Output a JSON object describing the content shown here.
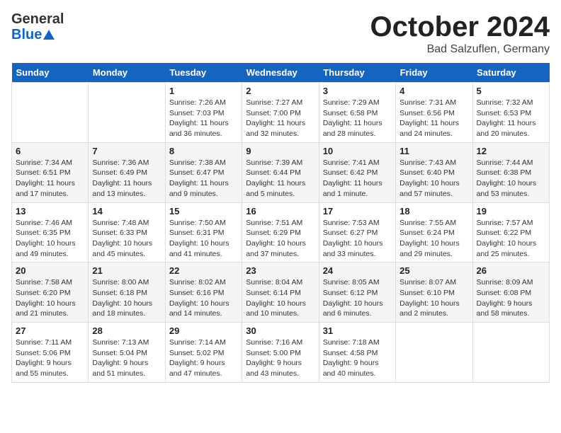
{
  "header": {
    "logo_line1": "General",
    "logo_line2": "Blue",
    "month": "October 2024",
    "location": "Bad Salzuflen, Germany"
  },
  "days_of_week": [
    "Sunday",
    "Monday",
    "Tuesday",
    "Wednesday",
    "Thursday",
    "Friday",
    "Saturday"
  ],
  "weeks": [
    [
      {
        "day": "",
        "info": ""
      },
      {
        "day": "",
        "info": ""
      },
      {
        "day": "1",
        "info": "Sunrise: 7:26 AM\nSunset: 7:03 PM\nDaylight: 11 hours\nand 36 minutes."
      },
      {
        "day": "2",
        "info": "Sunrise: 7:27 AM\nSunset: 7:00 PM\nDaylight: 11 hours\nand 32 minutes."
      },
      {
        "day": "3",
        "info": "Sunrise: 7:29 AM\nSunset: 6:58 PM\nDaylight: 11 hours\nand 28 minutes."
      },
      {
        "day": "4",
        "info": "Sunrise: 7:31 AM\nSunset: 6:56 PM\nDaylight: 11 hours\nand 24 minutes."
      },
      {
        "day": "5",
        "info": "Sunrise: 7:32 AM\nSunset: 6:53 PM\nDaylight: 11 hours\nand 20 minutes."
      }
    ],
    [
      {
        "day": "6",
        "info": "Sunrise: 7:34 AM\nSunset: 6:51 PM\nDaylight: 11 hours\nand 17 minutes."
      },
      {
        "day": "7",
        "info": "Sunrise: 7:36 AM\nSunset: 6:49 PM\nDaylight: 11 hours\nand 13 minutes."
      },
      {
        "day": "8",
        "info": "Sunrise: 7:38 AM\nSunset: 6:47 PM\nDaylight: 11 hours\nand 9 minutes."
      },
      {
        "day": "9",
        "info": "Sunrise: 7:39 AM\nSunset: 6:44 PM\nDaylight: 11 hours\nand 5 minutes."
      },
      {
        "day": "10",
        "info": "Sunrise: 7:41 AM\nSunset: 6:42 PM\nDaylight: 11 hours\nand 1 minute."
      },
      {
        "day": "11",
        "info": "Sunrise: 7:43 AM\nSunset: 6:40 PM\nDaylight: 10 hours\nand 57 minutes."
      },
      {
        "day": "12",
        "info": "Sunrise: 7:44 AM\nSunset: 6:38 PM\nDaylight: 10 hours\nand 53 minutes."
      }
    ],
    [
      {
        "day": "13",
        "info": "Sunrise: 7:46 AM\nSunset: 6:35 PM\nDaylight: 10 hours\nand 49 minutes."
      },
      {
        "day": "14",
        "info": "Sunrise: 7:48 AM\nSunset: 6:33 PM\nDaylight: 10 hours\nand 45 minutes."
      },
      {
        "day": "15",
        "info": "Sunrise: 7:50 AM\nSunset: 6:31 PM\nDaylight: 10 hours\nand 41 minutes."
      },
      {
        "day": "16",
        "info": "Sunrise: 7:51 AM\nSunset: 6:29 PM\nDaylight: 10 hours\nand 37 minutes."
      },
      {
        "day": "17",
        "info": "Sunrise: 7:53 AM\nSunset: 6:27 PM\nDaylight: 10 hours\nand 33 minutes."
      },
      {
        "day": "18",
        "info": "Sunrise: 7:55 AM\nSunset: 6:24 PM\nDaylight: 10 hours\nand 29 minutes."
      },
      {
        "day": "19",
        "info": "Sunrise: 7:57 AM\nSunset: 6:22 PM\nDaylight: 10 hours\nand 25 minutes."
      }
    ],
    [
      {
        "day": "20",
        "info": "Sunrise: 7:58 AM\nSunset: 6:20 PM\nDaylight: 10 hours\nand 21 minutes."
      },
      {
        "day": "21",
        "info": "Sunrise: 8:00 AM\nSunset: 6:18 PM\nDaylight: 10 hours\nand 18 minutes."
      },
      {
        "day": "22",
        "info": "Sunrise: 8:02 AM\nSunset: 6:16 PM\nDaylight: 10 hours\nand 14 minutes."
      },
      {
        "day": "23",
        "info": "Sunrise: 8:04 AM\nSunset: 6:14 PM\nDaylight: 10 hours\nand 10 minutes."
      },
      {
        "day": "24",
        "info": "Sunrise: 8:05 AM\nSunset: 6:12 PM\nDaylight: 10 hours\nand 6 minutes."
      },
      {
        "day": "25",
        "info": "Sunrise: 8:07 AM\nSunset: 6:10 PM\nDaylight: 10 hours\nand 2 minutes."
      },
      {
        "day": "26",
        "info": "Sunrise: 8:09 AM\nSunset: 6:08 PM\nDaylight: 9 hours\nand 58 minutes."
      }
    ],
    [
      {
        "day": "27",
        "info": "Sunrise: 7:11 AM\nSunset: 5:06 PM\nDaylight: 9 hours\nand 55 minutes."
      },
      {
        "day": "28",
        "info": "Sunrise: 7:13 AM\nSunset: 5:04 PM\nDaylight: 9 hours\nand 51 minutes."
      },
      {
        "day": "29",
        "info": "Sunrise: 7:14 AM\nSunset: 5:02 PM\nDaylight: 9 hours\nand 47 minutes."
      },
      {
        "day": "30",
        "info": "Sunrise: 7:16 AM\nSunset: 5:00 PM\nDaylight: 9 hours\nand 43 minutes."
      },
      {
        "day": "31",
        "info": "Sunrise: 7:18 AM\nSunset: 4:58 PM\nDaylight: 9 hours\nand 40 minutes."
      },
      {
        "day": "",
        "info": ""
      },
      {
        "day": "",
        "info": ""
      }
    ]
  ]
}
